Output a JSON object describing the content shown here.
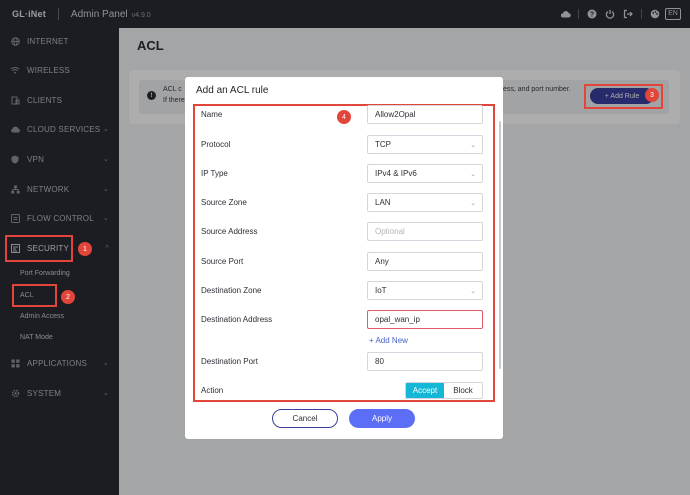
{
  "topbar": {
    "brand": "GL·iNet",
    "title": "Admin Panel",
    "version": "v4.9.0",
    "icons": [
      "cloud-icon",
      "help-icon",
      "power-icon",
      "logout-icon",
      "theme-icon"
    ],
    "language": "EN"
  },
  "sidebar": {
    "items": [
      {
        "label": "INTERNET",
        "icon": "globe-icon"
      },
      {
        "label": "WIRELESS",
        "icon": "wifi-icon"
      },
      {
        "label": "CLIENTS",
        "icon": "clients-icon"
      },
      {
        "label": "CLOUD SERVICES",
        "icon": "cloud-icon"
      },
      {
        "label": "VPN",
        "icon": "shield-icon"
      },
      {
        "label": "NETWORK",
        "icon": "network-icon"
      },
      {
        "label": "FLOW CONTROL",
        "icon": "flow-icon"
      },
      {
        "label": "SECURITY",
        "icon": "security-icon"
      },
      {
        "label": "APPLICATIONS",
        "icon": "apps-icon"
      },
      {
        "label": "SYSTEM",
        "icon": "gear-icon"
      }
    ],
    "security_sub": [
      "Port Forwarding",
      "ACL",
      "Admin Access",
      "NAT Mode"
    ]
  },
  "page": {
    "title": "ACL",
    "notice_line1": "ACL c",
    "notice_line2": "If there",
    "notice_right": "ess, and port number.",
    "add_rule_label": "+ Add Rule"
  },
  "annotations": [
    "1",
    "2",
    "3",
    "4"
  ],
  "modal": {
    "title": "Add an ACL rule",
    "fields": {
      "name": {
        "label": "Name",
        "value": "Allow2Opal"
      },
      "protocol": {
        "label": "Protocol",
        "value": "TCP"
      },
      "ip_type": {
        "label": "IP Type",
        "value": "IPv4 & IPv6"
      },
      "source_zone": {
        "label": "Source Zone",
        "value": "LAN"
      },
      "source_address": {
        "label": "Source Address",
        "placeholder": "Optional"
      },
      "source_port": {
        "label": "Source Port",
        "value": "Any"
      },
      "destination_zone": {
        "label": "Destination Zone",
        "value": "IoT"
      },
      "destination_address": {
        "label": "Destination Address",
        "value": "opal_wan_ip"
      },
      "destination_port": {
        "label": "Destination Port",
        "value": "80"
      },
      "action": {
        "label": "Action",
        "options": [
          "Accept",
          "Block"
        ],
        "selected": "Accept"
      }
    },
    "add_new_label": "+ Add New",
    "cancel_label": "Cancel",
    "apply_label": "Apply"
  },
  "colors": {
    "highlight": "#e2453a",
    "primary": "#5b6ef5",
    "accept": "#14b8d6"
  }
}
